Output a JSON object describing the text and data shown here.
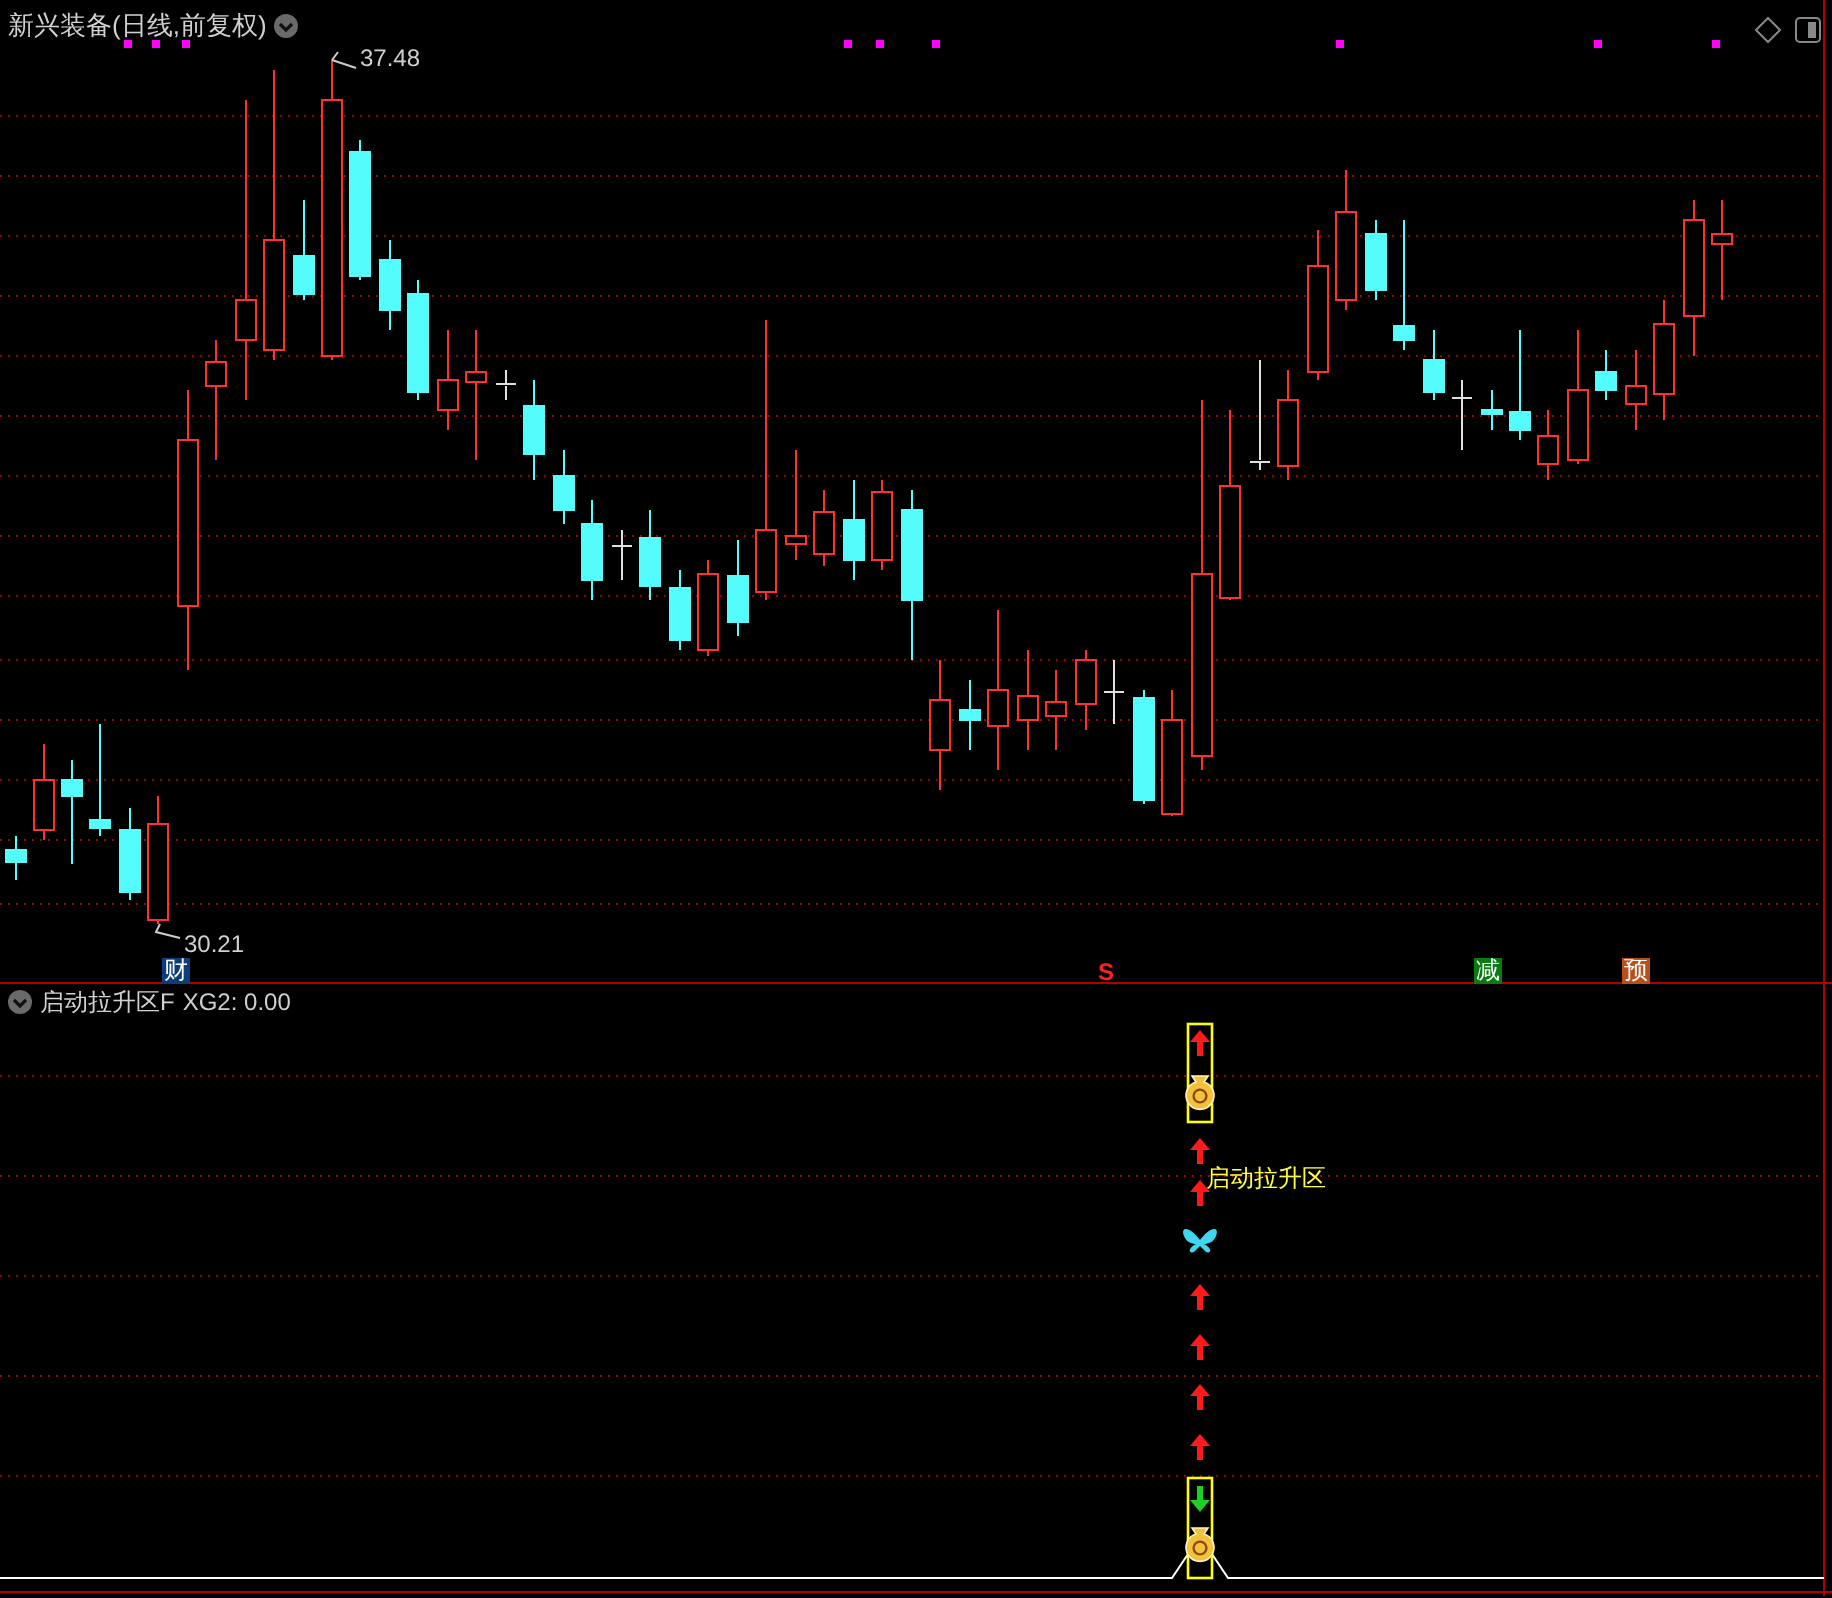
{
  "chart": {
    "title": "新兴装备(日线,前复权)",
    "high_label": "37.48",
    "low_label": "30.21",
    "markers": [
      {
        "kind": "badge",
        "text": "财",
        "color": "#0b3d7a"
      },
      {
        "kind": "signal",
        "text": "S",
        "color": "#ff2020"
      },
      {
        "kind": "badge",
        "text": "减",
        "color": "#0a7a12"
      },
      {
        "kind": "badge",
        "text": "预",
        "color": "#b8501c"
      }
    ]
  },
  "indicator": {
    "title": "启动拉升区F",
    "reading": "XG2: 0.00",
    "zone_label": "启动拉升区"
  }
}
